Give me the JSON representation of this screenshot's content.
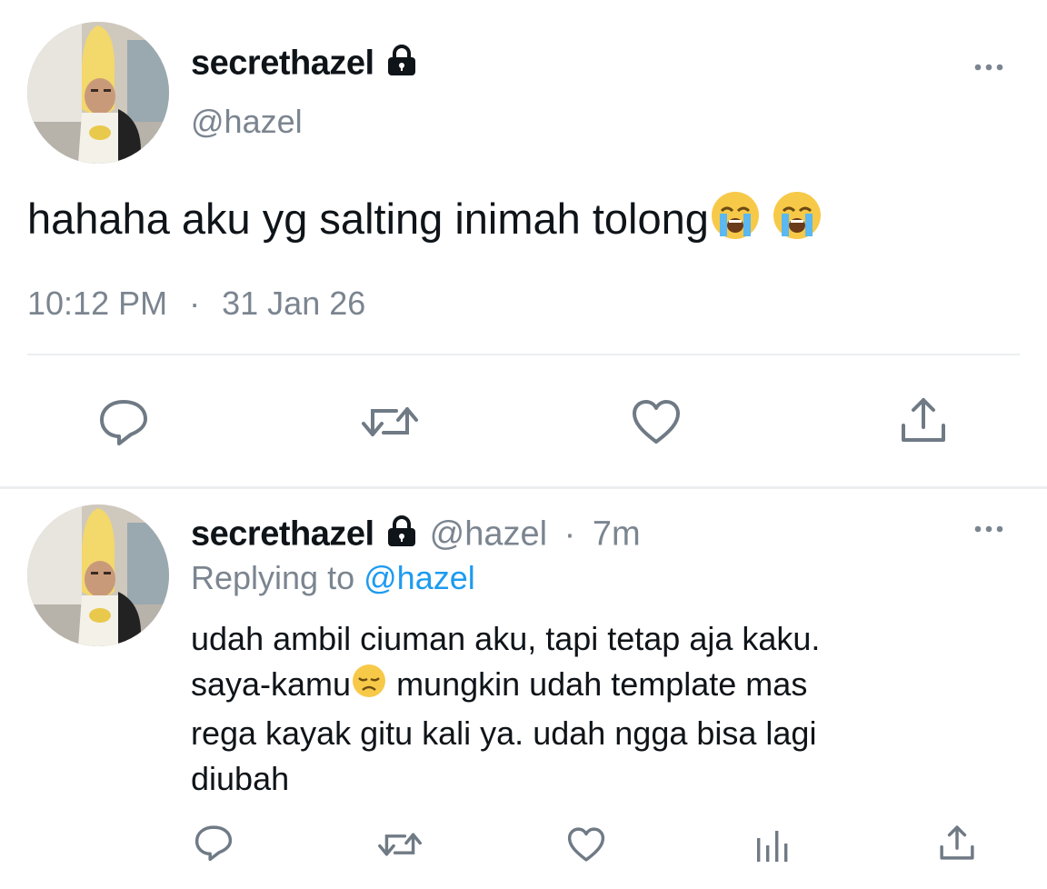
{
  "main_tweet": {
    "display_name": "secrethazel",
    "handle": "@hazel",
    "text": "hahaha aku yg salting inimah tolong",
    "emojis": [
      "loudly-crying-face",
      "loudly-crying-face"
    ],
    "time": "10:12 PM",
    "separator": "·",
    "date": "31 Jan 26",
    "more_icon": "more-horizontal-icon",
    "actions": [
      "reply-icon",
      "retweet-icon",
      "like-icon",
      "share-icon"
    ]
  },
  "reply": {
    "display_name": "secrethazel",
    "handle": "@hazel",
    "separator": "·",
    "age": "7m",
    "replying_prefix": "Replying to",
    "replying_handle": "@hazel",
    "line1": "udah ambil ciuman aku, tapi tetap aja kaku.",
    "line2_start": "saya-kamu",
    "line2_emoji": "disappointed-face",
    "line2_end": " mungkin udah template mas",
    "line3": "rega kayak gitu kali ya. udah ngga bisa lagi",
    "line4": "diubah",
    "more_icon": "more-horizontal-icon",
    "actions": [
      "reply-icon",
      "retweet-icon",
      "like-icon",
      "analytics-icon",
      "share-icon"
    ]
  },
  "colors": {
    "text": "#0f1419",
    "secondary": "#7b8590",
    "link": "#1d9bf0",
    "divider": "#eceef0"
  }
}
